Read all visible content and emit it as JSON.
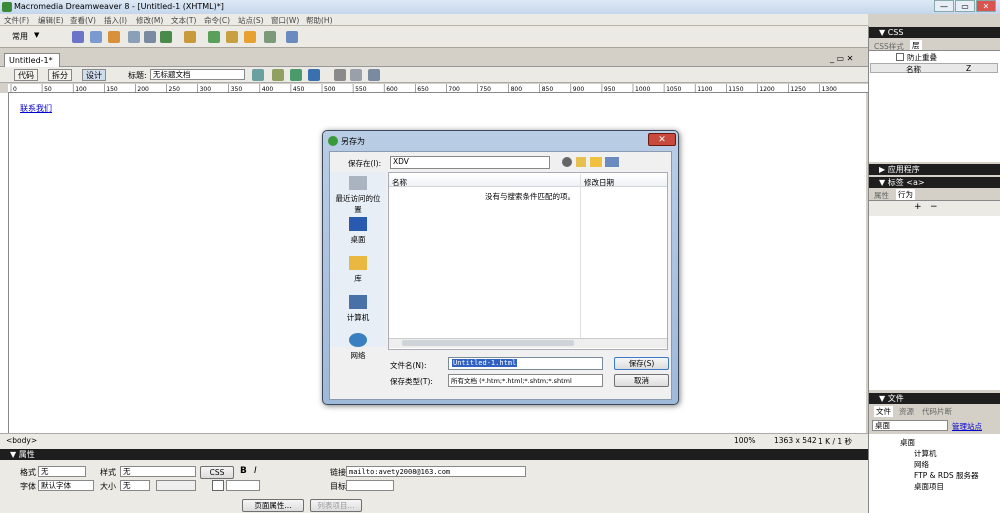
{
  "window": {
    "title": "Macromedia Dreamweaver 8 - [Untitled-1 (XHTML)*]",
    "min": "—",
    "max": "▭",
    "close": "✕"
  },
  "menu": [
    "文件(F)",
    "编辑(E)",
    "查看(V)",
    "插入(I)",
    "修改(M)",
    "文本(T)",
    "命令(C)",
    "站点(S)",
    "窗口(W)",
    "帮助(H)"
  ],
  "insert": {
    "category": "常用"
  },
  "document": {
    "tab": "Untitled-1*",
    "code": "代码",
    "split": "拆分",
    "design": "设计",
    "title_label": "标题:",
    "title_value": "无标题文档",
    "link_text": "联系我们",
    "doc_controls": "_ ▭ ✕"
  },
  "ruler_ticks": [
    "0",
    "50",
    "100",
    "150",
    "200",
    "250",
    "300",
    "350",
    "400",
    "450",
    "500",
    "550",
    "600",
    "650",
    "700",
    "750",
    "800",
    "850",
    "900",
    "950",
    "1000",
    "1050",
    "1100",
    "1150",
    "1200",
    "1250",
    "1300"
  ],
  "status": {
    "tag": "<body>",
    "zoom": "100%",
    "size": "1363 x 542",
    "filesize": "1 K / 1 秒"
  },
  "properties": {
    "header": "▼ 属性",
    "format_label": "格式",
    "format_value": "无",
    "style_label": "样式",
    "style_value": "无",
    "css_button": "CSS",
    "bold": "B",
    "italic": "I",
    "link_label": "链接",
    "link_value": "mailto:avety2008@163.com",
    "font_label": "字体",
    "font_value": "默认字体",
    "size_label": "大小",
    "size_value": "无",
    "target_label": "目标",
    "page_props": "页面属性...",
    "list_item": "列表项目..."
  },
  "panels": {
    "css": "▼ CSS",
    "css_tabs": [
      "CSS样式",
      "层"
    ],
    "prevent_overlap": "防止重叠",
    "layer_cols": [
      "名称",
      "Z"
    ],
    "app": "▶ 应用程序",
    "tag": "▼ 标签 <a>",
    "tag_tabs": [
      "属性",
      "行为"
    ],
    "files": "▼ 文件",
    "files_tabs": [
      "文件",
      "资源",
      "代码片断"
    ],
    "site_select": "桌面",
    "manage_site": "管理站点",
    "tree": [
      "桌面",
      "计算机",
      "网络",
      "FTP & RDS 服务器",
      "桌面项目"
    ]
  },
  "dialog": {
    "title": "另存为",
    "save_in_label": "保存在(I):",
    "save_in_value": "XDV",
    "places": [
      "最近访问的位置",
      "桌面",
      "库",
      "计算机",
      "网络"
    ],
    "col_name": "名称",
    "col_date": "修改日期",
    "empty_msg": "没有与搜索条件匹配的项。",
    "filename_label": "文件名(N):",
    "filename_value": "Untitled-1.html",
    "filetype_label": "保存类型(T):",
    "filetype_value": "所有文档 (*.htm;*.html;*.shtm;*.shtml",
    "save_button": "保存(S)",
    "cancel_button": "取消",
    "close": "✕"
  }
}
